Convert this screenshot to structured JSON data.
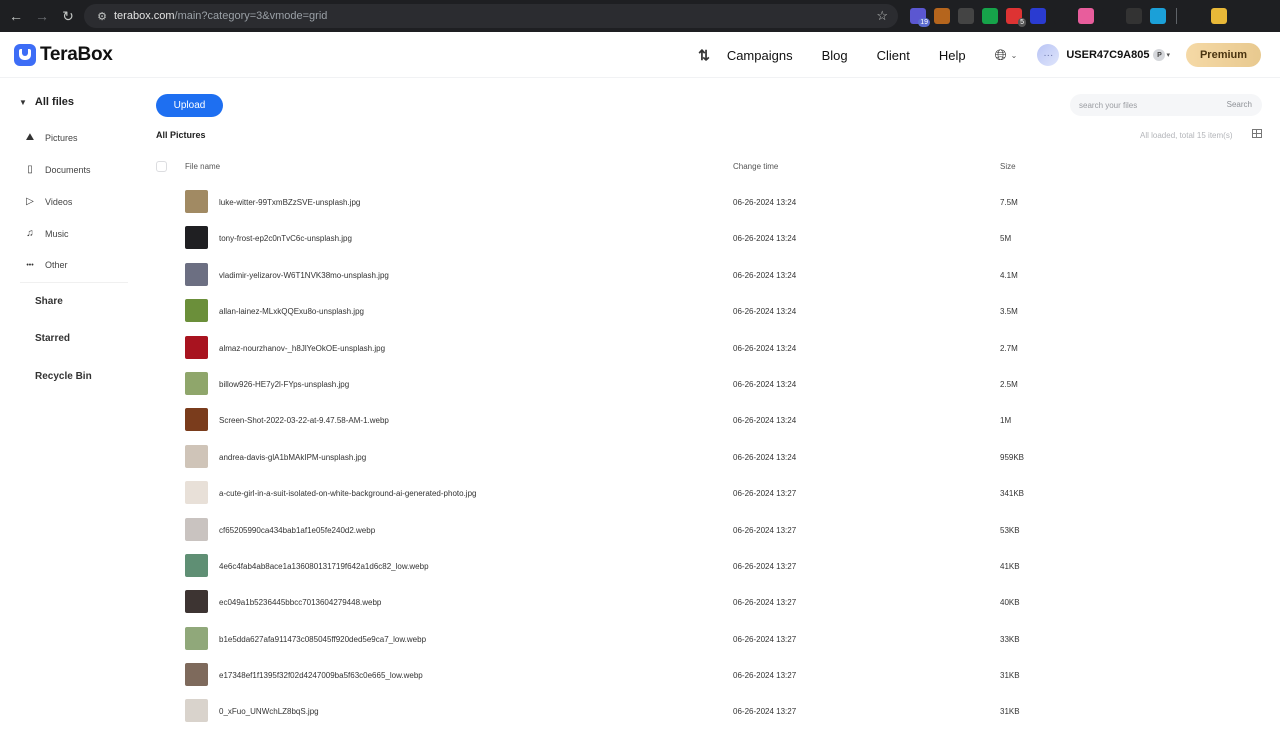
{
  "browser": {
    "back": "←",
    "forward": "→",
    "reload": "↻",
    "url_host": "terabox.com",
    "url_path": "/main?category=3&vmode=grid",
    "extensions": [
      {
        "name": "ext-mail",
        "color": "#5b57d1",
        "badge": "19"
      },
      {
        "name": "ext-tools",
        "color": "#b5651d",
        "badge": ""
      },
      {
        "name": "ext-shield",
        "color": "#444",
        "badge": ""
      },
      {
        "name": "ext-grammarly",
        "color": "#16a34a",
        "badge": ""
      },
      {
        "name": "ext-record",
        "color": "#d33",
        "badge": "5"
      },
      {
        "name": "ext-wm",
        "color": "#2a3bd1",
        "badge": ""
      },
      {
        "name": "ext-fonts",
        "color": "#1e1f22",
        "badge": ""
      },
      {
        "name": "ext-color",
        "color": "#e85d9c",
        "badge": ""
      },
      {
        "name": "ext-w",
        "color": "#1e1f22",
        "badge": ""
      },
      {
        "name": "ext-cloud",
        "color": "#333",
        "badge": ""
      },
      {
        "name": "ext-diamond",
        "color": "#1ba0d8",
        "badge": ""
      },
      {
        "name": "ext-puzzle",
        "color": "#1e1f22",
        "badge": ""
      },
      {
        "name": "ext-rainbow",
        "color": "#e8b838",
        "badge": ""
      }
    ]
  },
  "header": {
    "logo_text": "TeraBox",
    "nav": [
      "Campaigns",
      "Blog",
      "Client",
      "Help"
    ],
    "username": "USER47C9A805",
    "avatar_text": "···",
    "plan_tag": "P",
    "premium_label": "Premium"
  },
  "sidebar": {
    "all_files": "All files",
    "categories": [
      {
        "label": "Pictures",
        "icon": "image-icon",
        "glyph": "⛰"
      },
      {
        "label": "Documents",
        "icon": "document-icon",
        "glyph": "▯"
      },
      {
        "label": "Videos",
        "icon": "video-icon",
        "glyph": "▷"
      },
      {
        "label": "Music",
        "icon": "headphones-icon",
        "glyph": "♫"
      },
      {
        "label": "Other",
        "icon": "more-icon",
        "glyph": "•••"
      }
    ],
    "share": "Share",
    "starred": "Starred",
    "recycle_bin": "Recycle Bin"
  },
  "main": {
    "upload_label": "Upload",
    "search_placeholder": "search your files",
    "search_button": "Search",
    "breadcrumb": "All Pictures",
    "loaded_info": "All loaded, total 15 item(s)",
    "columns": {
      "name": "File name",
      "time": "Change time",
      "size": "Size"
    },
    "files": [
      {
        "name": "luke-witter-99TxmBZzSVE-unsplash.jpg",
        "time": "06-26-2024 13:24",
        "size": "7.5M",
        "thumb": "#a18a63"
      },
      {
        "name": "tony-frost-ep2c0nTvC6c-unsplash.jpg",
        "time": "06-26-2024 13:24",
        "size": "5M",
        "thumb": "#1f1f22"
      },
      {
        "name": "vladimir-yelizarov-W6T1NVK38mo-unsplash.jpg",
        "time": "06-26-2024 13:24",
        "size": "4.1M",
        "thumb": "#6c6f82"
      },
      {
        "name": "allan-lainez-MLxkQQExu8o-unsplash.jpg",
        "time": "06-26-2024 13:24",
        "size": "3.5M",
        "thumb": "#6b8f3a"
      },
      {
        "name": "almaz-nourzhanov-_h8JlYeOkOE-unsplash.jpg",
        "time": "06-26-2024 13:24",
        "size": "2.7M",
        "thumb": "#a8131f"
      },
      {
        "name": "billow926-HE7y2l-FYps-unsplash.jpg",
        "time": "06-26-2024 13:24",
        "size": "2.5M",
        "thumb": "#8fa66b"
      },
      {
        "name": "Screen-Shot-2022-03-22-at-9.47.58-AM-1.webp",
        "time": "06-26-2024 13:24",
        "size": "1M",
        "thumb": "#7a3c1c"
      },
      {
        "name": "andrea-davis-glA1bMAkIPM-unsplash.jpg",
        "time": "06-26-2024 13:24",
        "size": "959KB",
        "thumb": "#cfc4b8"
      },
      {
        "name": "a-cute-girl-in-a-suit-isolated-on-white-background-ai-generated-photo.jpg",
        "time": "06-26-2024 13:27",
        "size": "341KB",
        "thumb": "#e8e0d8"
      },
      {
        "name": "cf65205990ca434bab1af1e05fe240d2.webp",
        "time": "06-26-2024 13:27",
        "size": "53KB",
        "thumb": "#c9c3c0"
      },
      {
        "name": "4e6c4fab4ab8ace1a136080131719f642a1d6c82_low.webp",
        "time": "06-26-2024 13:27",
        "size": "41KB",
        "thumb": "#5f8f74"
      },
      {
        "name": "ec049a1b5236445bbcc7013604279448.webp",
        "time": "06-26-2024 13:27",
        "size": "40KB",
        "thumb": "#3d3432"
      },
      {
        "name": "b1e5dda627afa911473c085045ff920ded5e9ca7_low.webp",
        "time": "06-26-2024 13:27",
        "size": "33KB",
        "thumb": "#90a87a"
      },
      {
        "name": "e17348ef1f1395f32f02d4247009ba5f63c0e665_low.webp",
        "time": "06-26-2024 13:27",
        "size": "31KB",
        "thumb": "#7e6a5c"
      },
      {
        "name": "0_xFuo_UNWchLZ8bqS.jpg",
        "time": "06-26-2024 13:27",
        "size": "31KB",
        "thumb": "#d9d3cc"
      }
    ]
  }
}
